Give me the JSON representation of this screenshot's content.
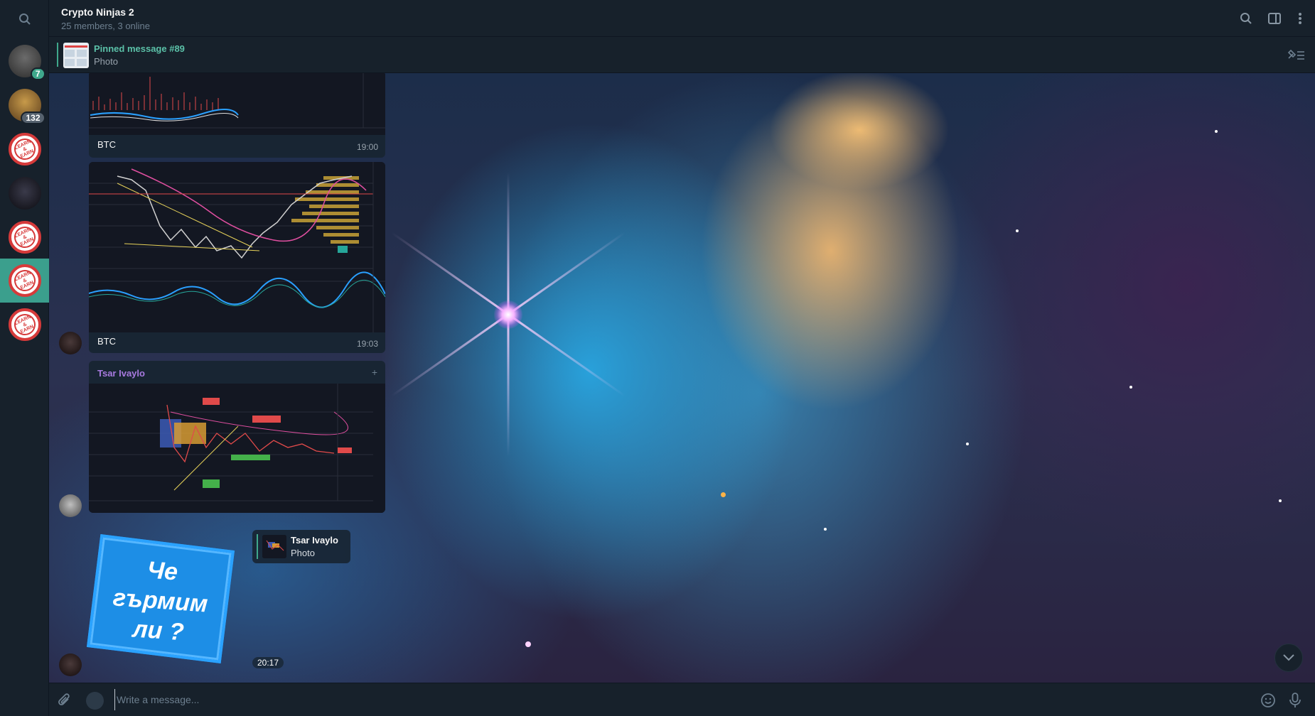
{
  "header": {
    "title": "Crypto Ninjas 2",
    "subtitle": "25 members, 3 online"
  },
  "sidebar": {
    "items": [
      {
        "name": "chat-avatar-1",
        "badge": "7"
      },
      {
        "name": "chat-avatar-2",
        "badge": "132"
      },
      {
        "name": "chat-avatar-3"
      },
      {
        "name": "chat-avatar-4"
      },
      {
        "name": "chat-avatar-5"
      },
      {
        "name": "chat-avatar-6"
      },
      {
        "name": "chat-avatar-7"
      }
    ]
  },
  "pinned": {
    "title": "Pinned message #89",
    "subtitle": "Photo"
  },
  "messages": [
    {
      "caption": "BTC",
      "time": "19:00"
    },
    {
      "caption": "BTC",
      "time": "19:03"
    },
    {
      "sender": "Tsar Ivaylo",
      "plus": "+"
    }
  ],
  "reply": {
    "name": "Tsar Ivaylo",
    "subtitle": "Photo"
  },
  "sticker": {
    "line1": "Че",
    "line2": "гърмим",
    "line3": "ли ?",
    "time": "20:17"
  },
  "composer": {
    "placeholder": "Write a message..."
  },
  "colors": {
    "accent": "#3fa88c",
    "sender_name": "#a87ae0",
    "background": "#17212b"
  }
}
